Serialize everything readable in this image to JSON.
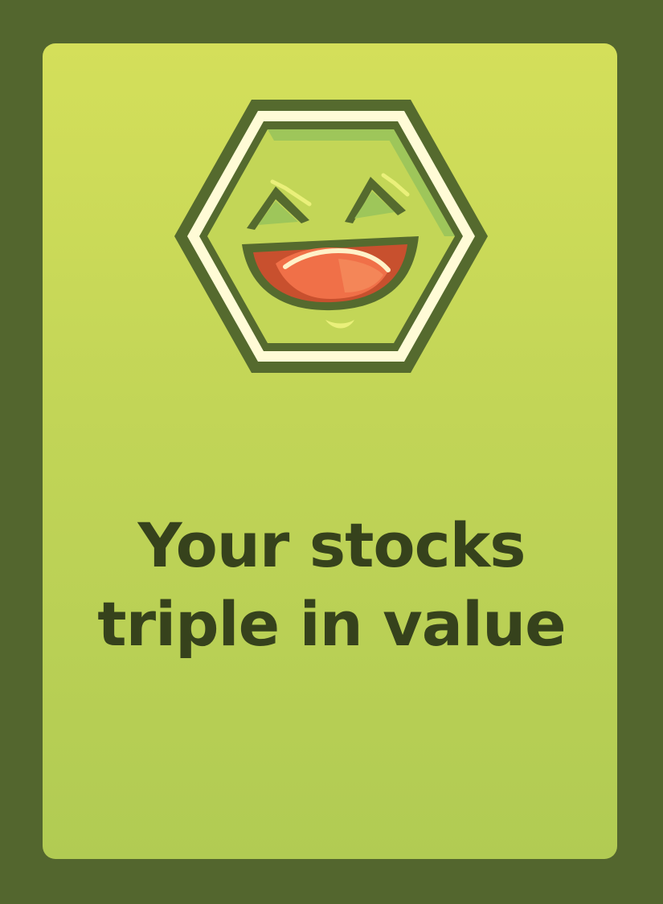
{
  "card": {
    "message_lines": [
      "Your stocks",
      "triple in value"
    ],
    "emblem_icon": "laughing-face-hexagon-icon"
  },
  "colors": {
    "frame": "#53662e",
    "card_top": "#d4df5a",
    "card_bottom": "#b1cb53",
    "text": "#36421c",
    "hex_outline": "#556a2e",
    "hex_rim": "#fffbd6",
    "mouth": "#c8502e",
    "tongue": "#f07048"
  }
}
